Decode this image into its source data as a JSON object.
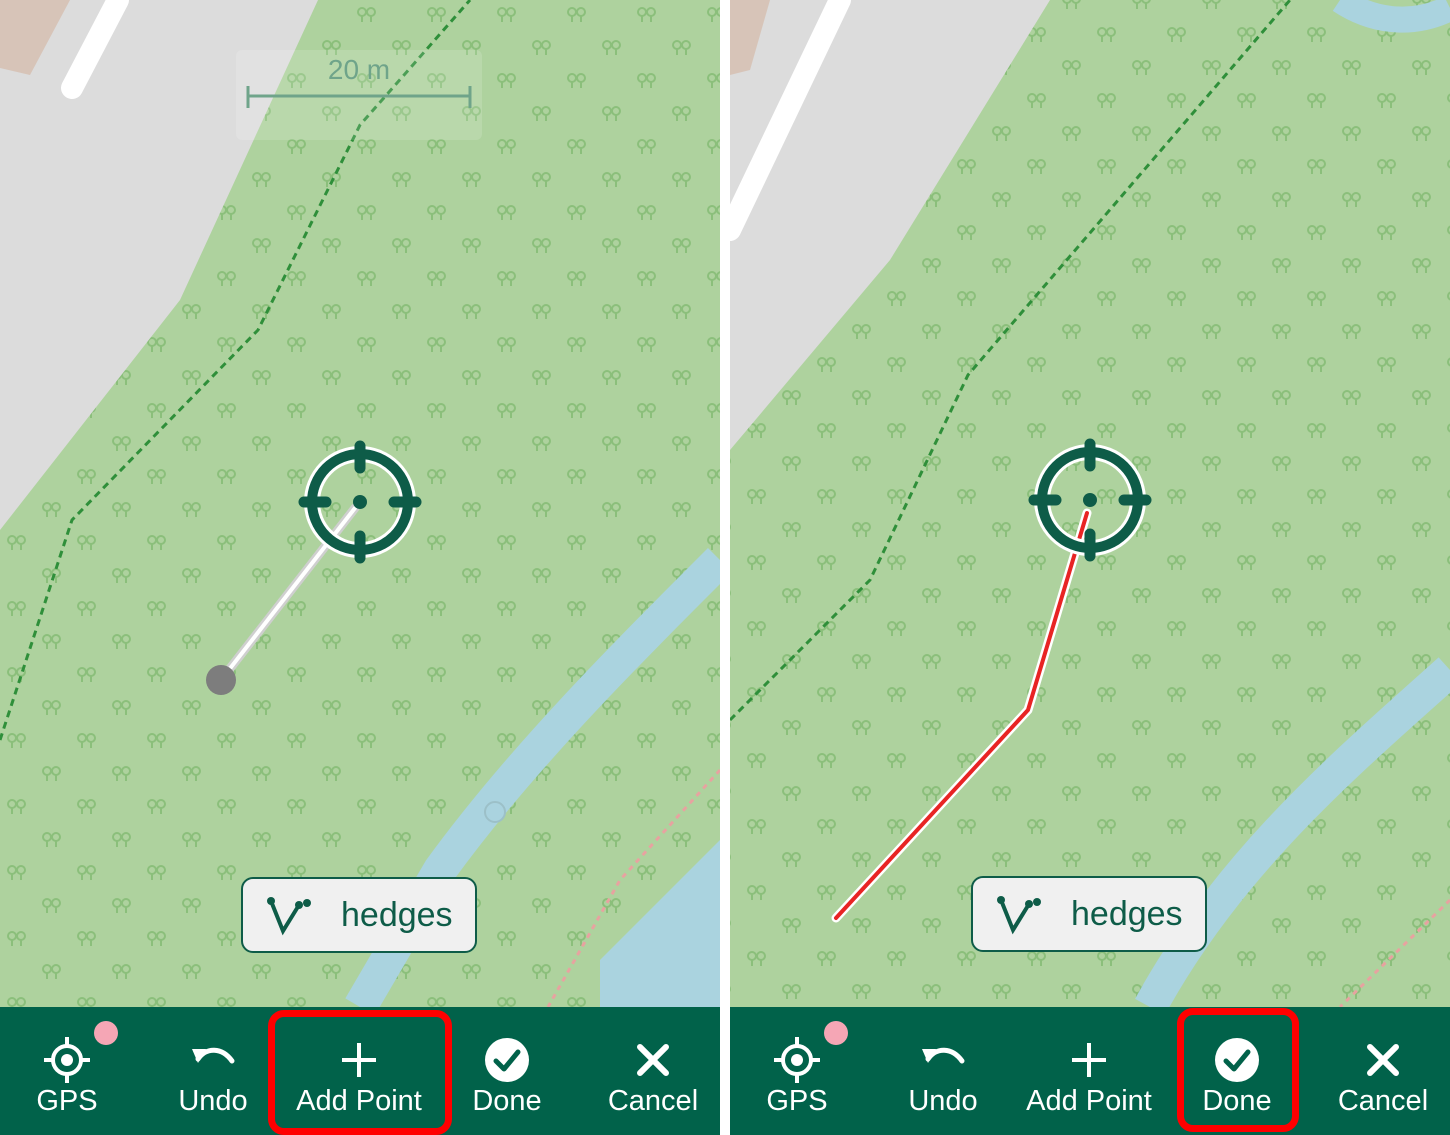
{
  "colors": {
    "park": "#aed29e",
    "road": "#dcdcdc",
    "water": "#aad3df",
    "toolbar": "#01624a",
    "accent": "#0e5c48",
    "highlight": "#ff0000",
    "line_pending": "#ffffff",
    "line_drawn": "#e82424",
    "gps_dot": "#f5a6b5"
  },
  "left_screen": {
    "scale": {
      "label": "20 m"
    },
    "layer": {
      "icon": "polyline-icon",
      "label": "hedges"
    },
    "toolbar": [
      {
        "id": "gps",
        "label": "GPS",
        "icon": "gps-target-icon"
      },
      {
        "id": "undo",
        "label": "Undo",
        "icon": "undo-icon"
      },
      {
        "id": "add",
        "label": "Add Point",
        "icon": "plus-icon"
      },
      {
        "id": "done",
        "label": "Done",
        "icon": "check-circle-icon"
      },
      {
        "id": "cancel",
        "label": "Cancel",
        "icon": "close-icon"
      }
    ],
    "highlighted": "Add Point"
  },
  "right_screen": {
    "layer": {
      "icon": "polyline-icon",
      "label": "hedges"
    },
    "toolbar": [
      {
        "id": "gps",
        "label": "GPS",
        "icon": "gps-target-icon"
      },
      {
        "id": "undo",
        "label": "Undo",
        "icon": "undo-icon"
      },
      {
        "id": "add",
        "label": "Add Point",
        "icon": "plus-icon"
      },
      {
        "id": "done",
        "label": "Done",
        "icon": "check-circle-icon"
      },
      {
        "id": "cancel",
        "label": "Cancel",
        "icon": "close-icon"
      }
    ],
    "highlighted": "Done"
  }
}
